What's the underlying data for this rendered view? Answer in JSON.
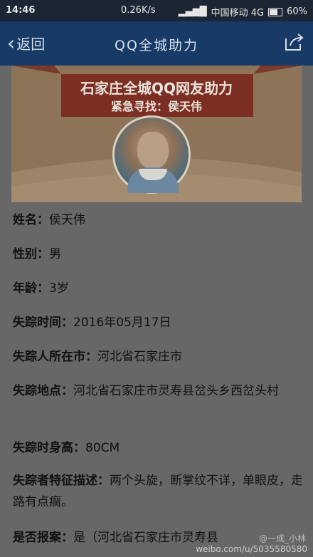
{
  "status_bar": {
    "time": "14:46",
    "net_speed": "0.26K/s",
    "carrier": "中国移动 4G",
    "battery": "60%"
  },
  "nav": {
    "back_label": "返回",
    "title": "QQ全城助力"
  },
  "banner": {
    "line1": "石家庄全城QQ网友助力",
    "line2": "紧急寻找：侯天伟"
  },
  "fields": {
    "name": {
      "label": "姓名：",
      "value": "侯天伟"
    },
    "gender": {
      "label": "性别：",
      "value": "男"
    },
    "age": {
      "label": "年龄：",
      "value": "3岁"
    },
    "missing_time": {
      "label": "失踪时间：",
      "value": "2016年05月17日"
    },
    "residence": {
      "label": "失踪人所在市：",
      "value": "河北省石家庄市"
    },
    "location": {
      "label": "失踪地点：",
      "value": "河北省石家庄市灵寿县岔头乡西岔头村"
    },
    "height": {
      "label": "失踪时身高：",
      "value": "80CM"
    },
    "features": {
      "label": "失踪者特征描述：",
      "value": "两个头旋，断掌纹不详，单眼皮，走路有点瘸。"
    },
    "reported": {
      "label": "是否报案：",
      "value": "是（河北省石家庄市灵寿县"
    }
  },
  "watermark": {
    "top": "@一成_小林",
    "bottom": "weibo.com/u/5035580580"
  },
  "colors": {
    "status_bg": "#1c2533",
    "nav_bg": "#173a67",
    "page_bg": "#676767"
  }
}
